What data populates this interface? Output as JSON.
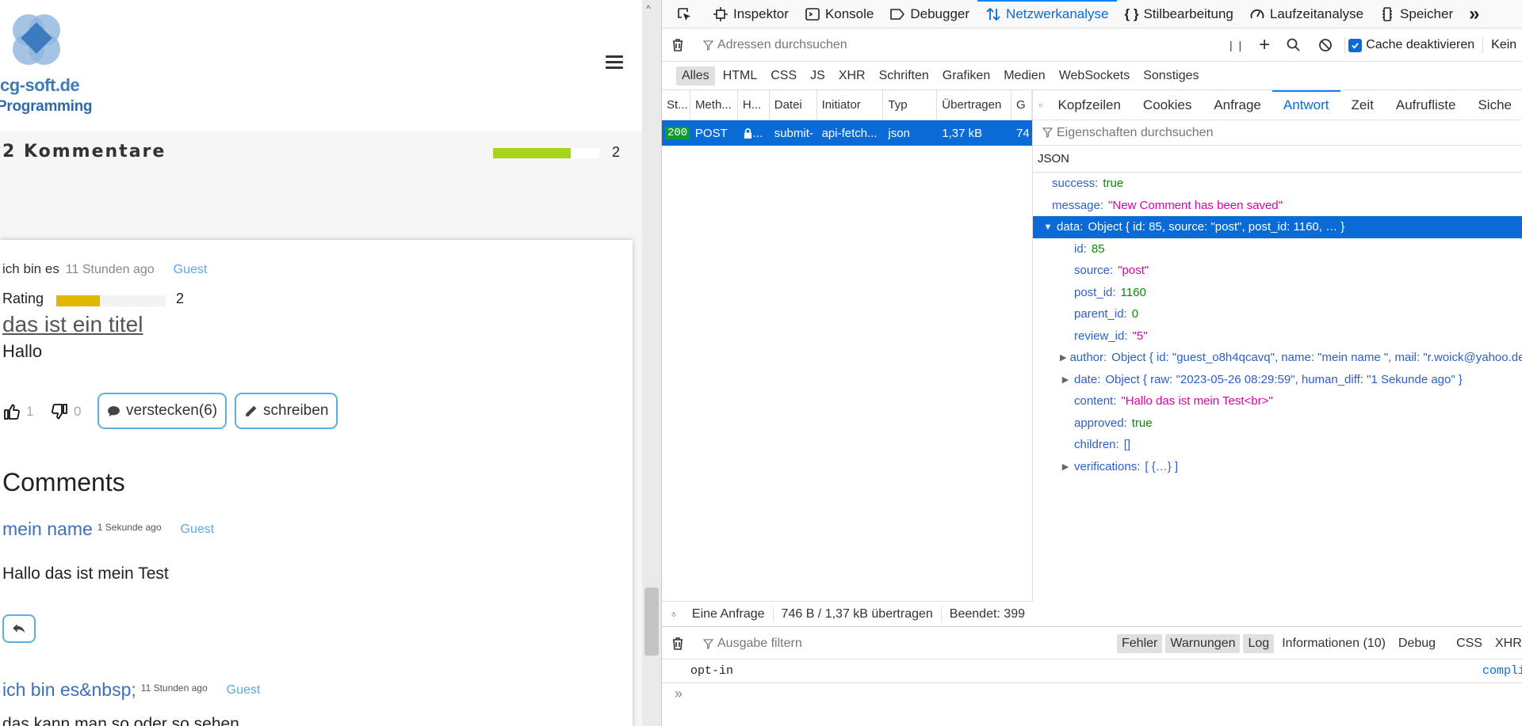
{
  "site": {
    "logo_text": "cg-soft.de",
    "logo_sub": "Programming",
    "comments_title": "2 Kommentare",
    "comments_count": "2",
    "comments_bar_fill": 0.73
  },
  "review": {
    "author": "ich bin es",
    "time": "11 Stunden ago",
    "role": "Guest",
    "rating_label": "Rating",
    "rating_value": "2",
    "rating_fill": 0.4,
    "title": "das ist ein titel",
    "body": "Hallo",
    "likes": "1",
    "dislikes": "0",
    "hide_button": "verstecken(6)",
    "write_button": "schreiben"
  },
  "comments": {
    "heading": "Comments",
    "items": [
      {
        "author": "mein name",
        "time": "1 Sekunde ago",
        "role": "Guest",
        "text": "Hallo das ist mein Test"
      },
      {
        "author": "ich bin es&nbsp;",
        "time": "11 Stunden ago",
        "role": "Guest",
        "text": "das kann man so oder so sehen"
      }
    ]
  },
  "devtools": {
    "tabs": [
      "Inspektor",
      "Konsole",
      "Debugger",
      "Netzwerkanalyse",
      "Stilbearbeitung",
      "Laufzeitanalyse",
      "Speicher"
    ],
    "active_tab": "Netzwerkanalyse",
    "url_filter_placeholder": "Adressen durchsuchen",
    "pause_label": "| |",
    "cache_disable": "Cache deaktivieren",
    "throttle": "Kein",
    "type_filters": [
      "Alles",
      "HTML",
      "CSS",
      "JS",
      "XHR",
      "Schriften",
      "Grafiken",
      "Medien",
      "WebSockets",
      "Sonstiges"
    ],
    "columns": [
      "St...",
      "Meth...",
      "H...",
      "Datei",
      "Initiator",
      "Typ",
      "Übertragen",
      "G"
    ],
    "request": {
      "status": "200",
      "method": "POST",
      "host": "...",
      "file": "submit-",
      "initiator": "api-fetch...",
      "type": "json",
      "transferred": "1,37 kB",
      "size": "74"
    },
    "detail_tabs": [
      "Kopfzeilen",
      "Cookies",
      "Anfrage",
      "Antwort",
      "Zeit",
      "Aufrufliste",
      "Siche"
    ],
    "active_detail_tab": "Antwort",
    "prop_filter_placeholder": "Eigenschaften durchsuchen",
    "json_label": "JSON",
    "json": [
      {
        "key": "success:",
        "value": "true",
        "kind": "bool",
        "level": 0
      },
      {
        "key": "message:",
        "value": "\"New Comment has been saved\"",
        "kind": "str",
        "level": 0
      },
      {
        "key": "data:",
        "value": "Object { id: 85, source: \"post\", post_id: 1160, … }",
        "kind": "obj",
        "level": 0,
        "twisty": "open",
        "selected": true
      },
      {
        "key": "id:",
        "value": "85",
        "kind": "num",
        "level": 1
      },
      {
        "key": "source:",
        "value": "\"post\"",
        "kind": "str",
        "level": 1
      },
      {
        "key": "post_id:",
        "value": "1160",
        "kind": "num",
        "level": 1
      },
      {
        "key": "parent_id:",
        "value": "0",
        "kind": "num",
        "level": 1
      },
      {
        "key": "review_id:",
        "value": "\"5\"",
        "kind": "str",
        "level": 1
      },
      {
        "key": "author:",
        "value": "Object { id: \"guest_o8h4qcavq\", name: \"mein name \", mail: \"r.woick@yahoo.de\"",
        "kind": "obj",
        "level": 1,
        "twisty": "closed"
      },
      {
        "key": "date:",
        "value": "Object { raw: \"2023-05-26 08:29:59\", human_diff: \"1 Sekunde ago\" }",
        "kind": "obj",
        "level": 1,
        "twisty": "closed"
      },
      {
        "key": "content:",
        "value": "\"Hallo das ist mein Test<br>\"",
        "kind": "str",
        "level": 1
      },
      {
        "key": "approved:",
        "value": "true",
        "kind": "bool",
        "level": 1
      },
      {
        "key": "children:",
        "value": "[]",
        "kind": "obj",
        "level": 1
      },
      {
        "key": "verifications:",
        "value": "[ {…} ]",
        "kind": "obj",
        "level": 1,
        "twisty": "closed"
      }
    ],
    "status_bar": [
      "Eine Anfrage",
      "746 B / 1,37 kB übertragen",
      "Beendet: 399"
    ],
    "console_filter_placeholder": "Ausgabe filtern",
    "console_levels": [
      {
        "label": "Fehler",
        "on": true
      },
      {
        "label": "Warnungen",
        "on": true
      },
      {
        "label": "Log",
        "on": true
      },
      {
        "label": "Informationen (10)",
        "on": false
      },
      {
        "label": "Debug",
        "on": false
      },
      {
        "label": "CSS",
        "on": false
      },
      {
        "label": "XHR",
        "on": false
      }
    ],
    "console_message": "opt-in",
    "console_source": "compli",
    "console_prompt": "»"
  },
  "colors": {
    "accent": "#0a6ad6",
    "link": "#3e6fbb",
    "count_bar": "#a6d51a",
    "rating_bar": "#e0b800"
  }
}
